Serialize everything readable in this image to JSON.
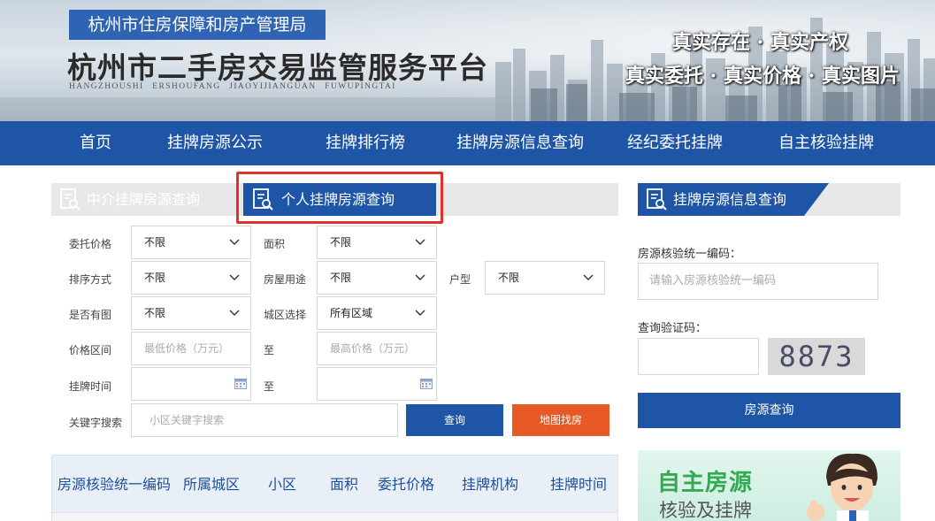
{
  "header": {
    "agency": "杭州市住房保障和房产管理局",
    "title": "杭州市二手房交易监管服务平台",
    "pinyin": "HANGZHOUSHI  ERSHOUFANG  JIAOYIJIANGUAN  FUWUPINGTAI",
    "slogan_line1": "真实存在 · 真实产权",
    "slogan_line2": "真实委托 · 真实价格 · 真实图片"
  },
  "nav": {
    "items": [
      "首页",
      "挂牌房源公示",
      "挂牌排行榜",
      "挂牌房源信息查询",
      "经纪委托挂牌",
      "自主核验挂牌"
    ]
  },
  "tabs": {
    "agent": "中介挂牌房源查询",
    "personal": "个人挂牌房源查询"
  },
  "form": {
    "price_label": "委托价格",
    "price_value": "不限",
    "area_label": "面积",
    "area_value": "不限",
    "sort_label": "排序方式",
    "sort_value": "不限",
    "usage_label": "房屋用途",
    "usage_value": "不限",
    "layout_label": "户型",
    "layout_value": "不限",
    "image_label": "是否有图",
    "image_value": "不限",
    "district_label": "城区选择",
    "district_value": "所有区域",
    "price_range_label": "价格区间",
    "min_price_placeholder": "最低价格（万元）",
    "to1": "至",
    "max_price_placeholder": "最高价格（万元）",
    "time_label": "挂牌时间",
    "to2": "至",
    "keyword_label": "关键字搜索",
    "keyword_placeholder": "小区关键字搜索",
    "search_btn": "查询",
    "map_btn": "地图找房"
  },
  "table": {
    "headers": [
      "房源核验统一编码",
      "所属城区",
      "小区",
      "面积",
      "委托价格",
      "挂牌机构",
      "挂牌时间"
    ]
  },
  "side": {
    "title": "挂牌房源信息查询",
    "code_label": "房源核验统一编码：",
    "code_placeholder": "请输入房源核验统一编码",
    "captcha_label": "查询验证码：",
    "captcha_text": "8873",
    "query_btn": "房源查询",
    "promo_title": "自主房源",
    "promo_sub": "核验及挂牌"
  },
  "colors": {
    "primary_blue": "#1e55a6",
    "map_orange": "#e85a25",
    "highlight_red": "#e2312c",
    "promo_green": "#34a853"
  }
}
